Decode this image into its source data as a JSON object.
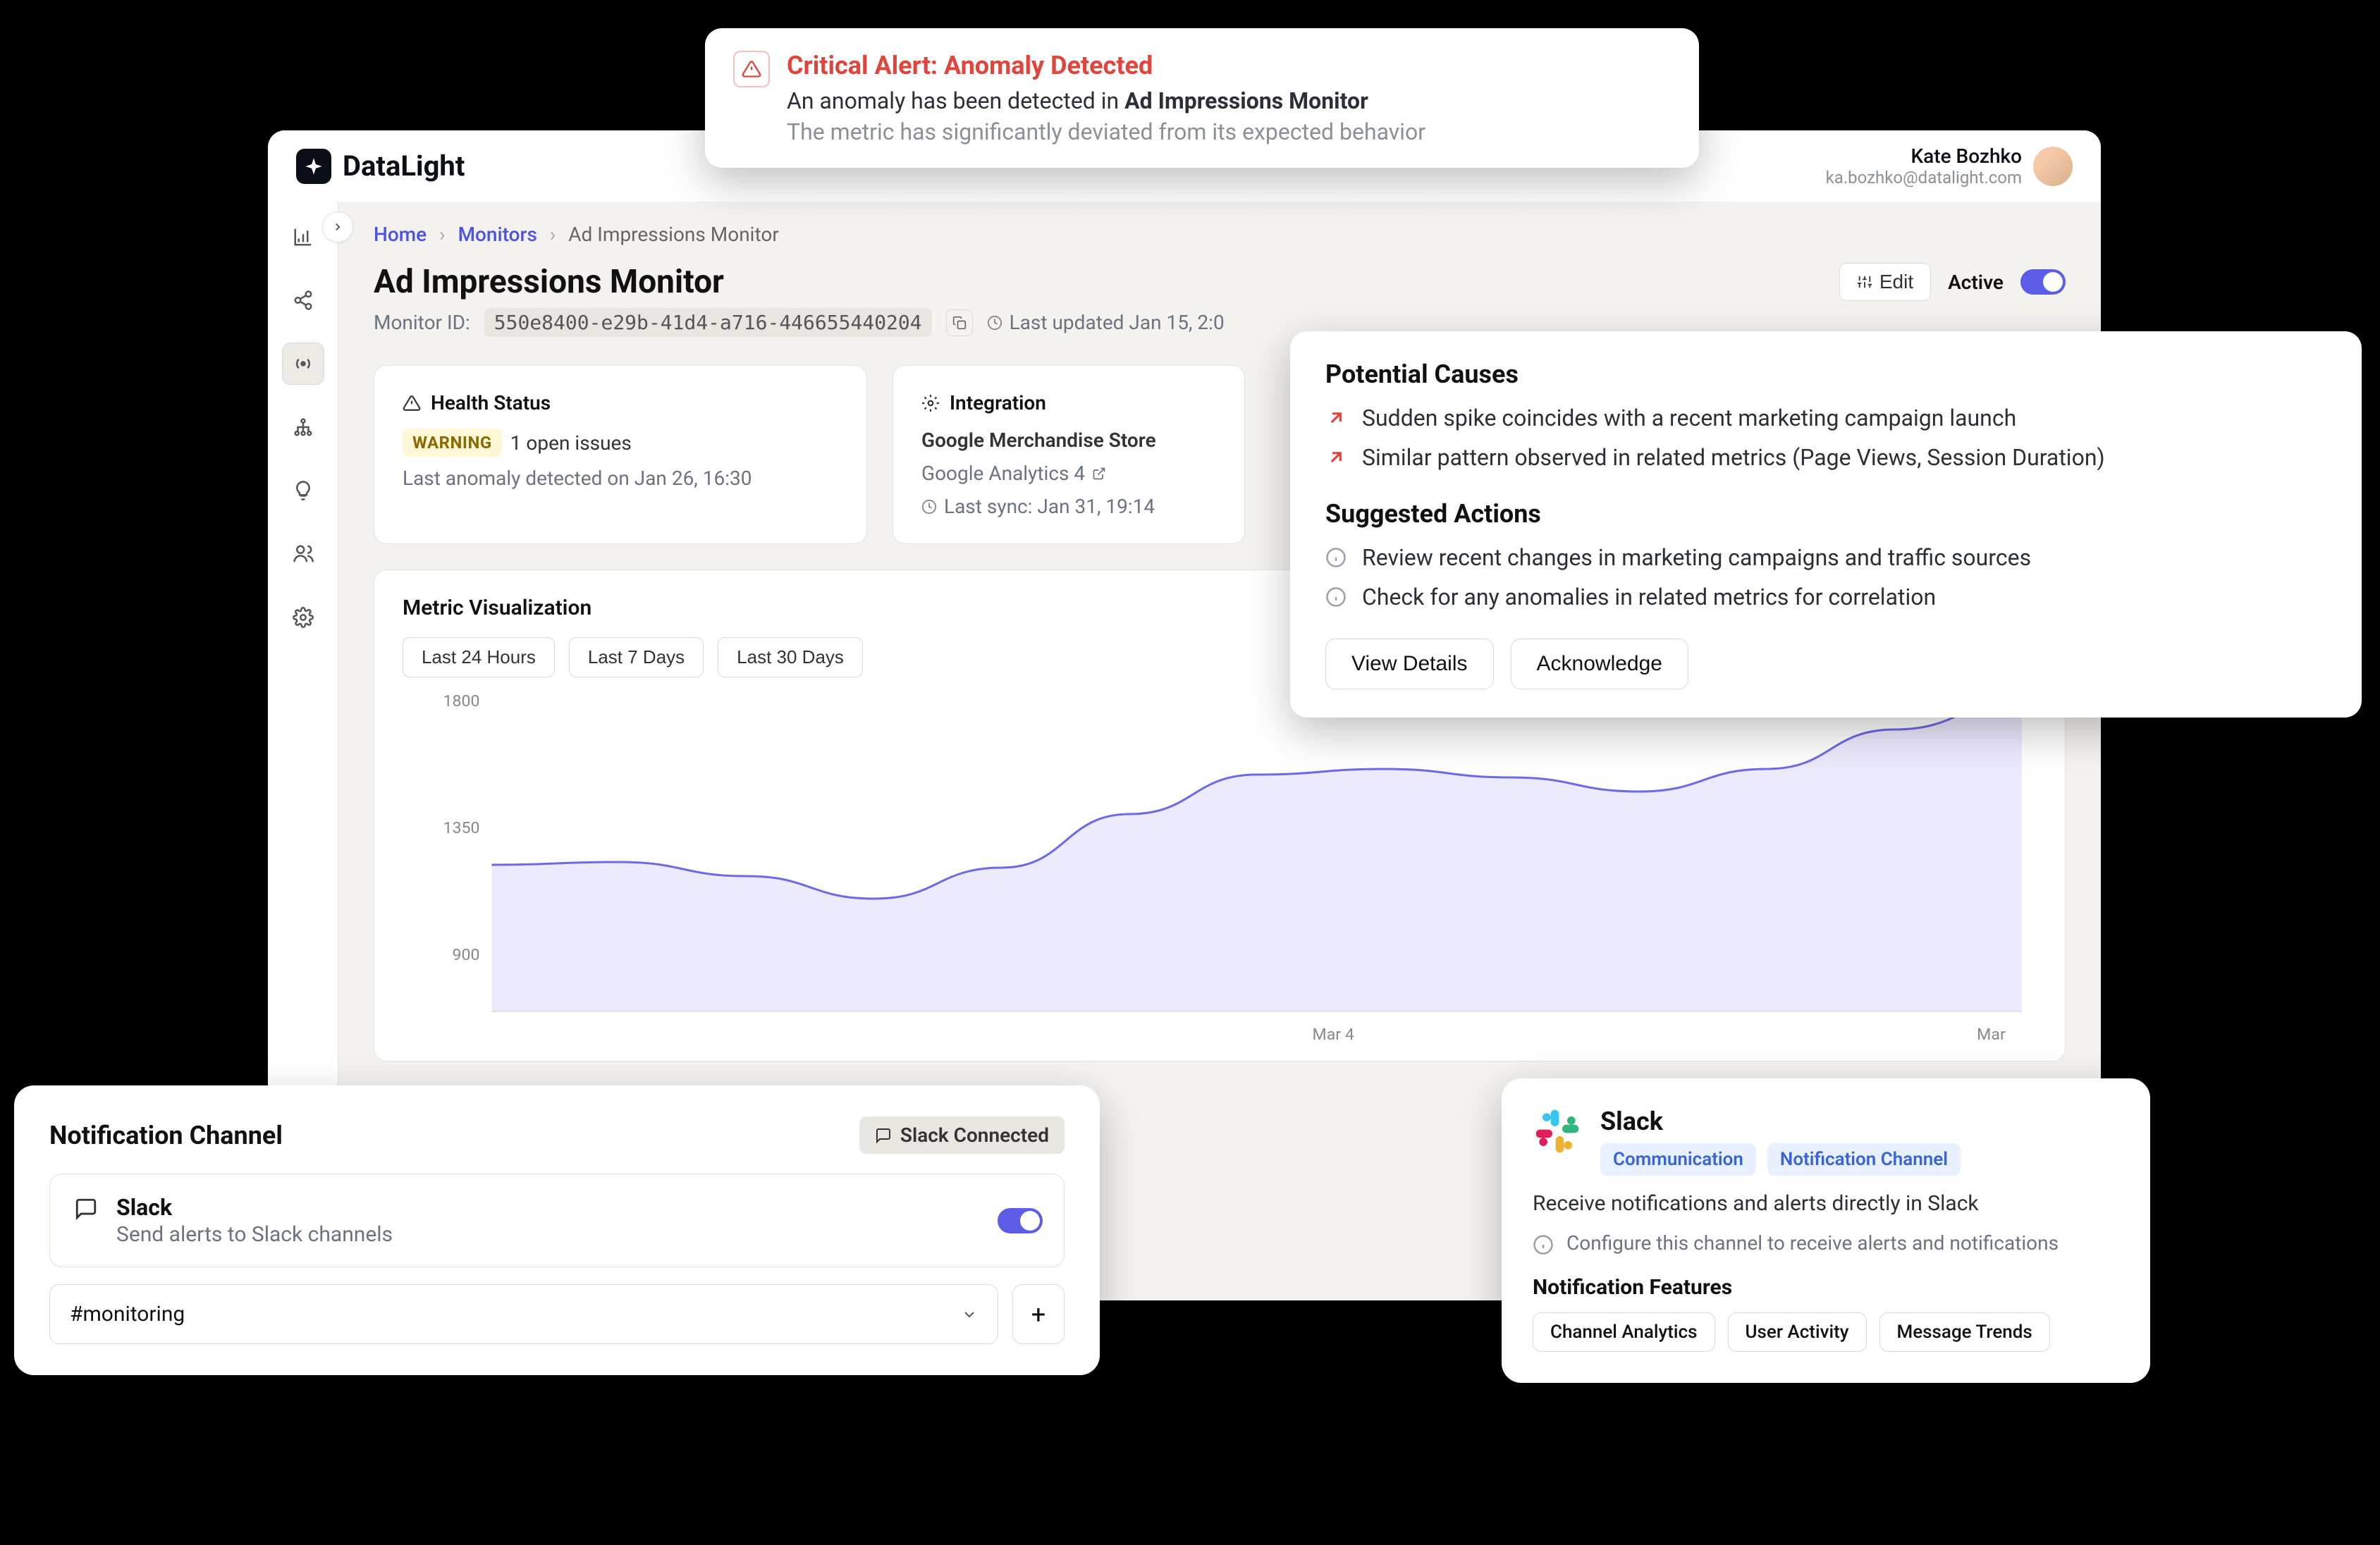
{
  "brand": {
    "name": "DataLight"
  },
  "user": {
    "name": "Kate Bozhko",
    "email": "ka.bozhko@datalight.com"
  },
  "breadcrumbs": {
    "home": "Home",
    "monitors": "Monitors",
    "current": "Ad Impressions Monitor"
  },
  "page": {
    "title": "Ad Impressions Monitor",
    "monitor_id_label": "Monitor ID:",
    "monitor_id": "550e8400-e29b-41d4-a716-446655440204",
    "last_updated": "Last updated Jan 15, 2:0",
    "edit_label": "Edit",
    "active_label": "Active"
  },
  "health_card": {
    "title": "Health Status",
    "badge": "WARNING",
    "issues": "1 open issues",
    "last_anomaly": "Last anomaly detected on Jan 26, 16:30"
  },
  "integration_card": {
    "title": "Integration",
    "name": "Google Merchandise Store",
    "source": "Google Analytics 4",
    "last_sync": "Last sync: Jan 31, 19:14"
  },
  "viz": {
    "title": "Metric Visualization",
    "ranges": [
      "Last 24 Hours",
      "Last 7 Days",
      "Last 30 Days"
    ]
  },
  "alert": {
    "title": "Critical Alert: Anomaly Detected",
    "line1_pre": "An anomaly has been detected in ",
    "line1_strong": "Ad Impressions Monitor",
    "line2": "The metric has significantly deviated from its expected behavior"
  },
  "causes": {
    "heading": "Potential Causes",
    "items": [
      "Sudden spike coincides with a recent marketing campaign launch",
      "Similar pattern observed in related metrics (Page Views, Session Duration)"
    ],
    "actions_heading": "Suggested Actions",
    "actions": [
      "Review recent changes in marketing campaigns and traffic sources",
      "Check for any anomalies in related metrics for correlation"
    ],
    "view_details": "View Details",
    "acknowledge": "Acknowledge"
  },
  "notif": {
    "heading": "Notification Channel",
    "connected_chip": "Slack Connected",
    "slack_name": "Slack",
    "slack_desc": "Send alerts to Slack channels",
    "selected_channel": "#monitoring"
  },
  "slack_detail": {
    "title": "Slack",
    "tags": [
      "Communication",
      "Notification Channel"
    ],
    "desc": "Receive notifications and alerts directly in Slack",
    "config": "Configure this channel to receive alerts and notifications",
    "features_heading": "Notification Features",
    "features": [
      "Channel Analytics",
      "User Activity",
      "Message Trends"
    ]
  },
  "chart_data": {
    "type": "line",
    "title": "Metric Visualization",
    "ylabel": "",
    "ylim": [
      700,
      1800
    ],
    "y_ticks": [
      1800,
      1350,
      900
    ],
    "baseline": 1000,
    "x_ticks": [
      "Mar 4",
      "Mar"
    ],
    "series": [
      {
        "name": "Ad Impressions",
        "values": [
          1220,
          1230,
          1180,
          1100,
          1210,
          1400,
          1540,
          1560,
          1530,
          1480,
          1560,
          1700,
          1800
        ]
      }
    ]
  }
}
